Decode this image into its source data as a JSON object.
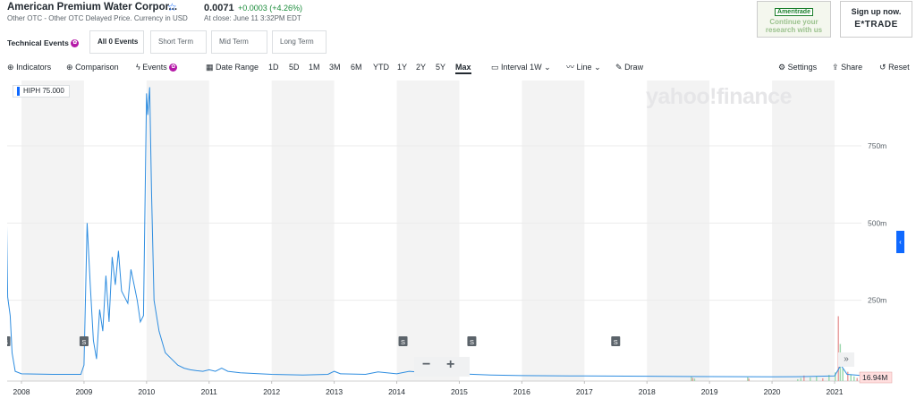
{
  "quote": {
    "name": "American Premium Water Corpor...",
    "exchange_info": "Other OTC - Other OTC Delayed Price. Currency in USD",
    "price": "0.0071",
    "change": "+0.0003 (+4.26%)",
    "close_time": "At close: June 11 3:32PM EDT"
  },
  "technical_events": {
    "label": "Technical Events",
    "badge": "✿",
    "buttons": [
      "All 0 Events",
      "Short Term",
      "Mid Term",
      "Long Term"
    ]
  },
  "toolbar": {
    "indicators": "Indicators",
    "comparison": "Comparison",
    "events": "Events",
    "date_range": "Date Range",
    "periods": [
      "1D",
      "5D",
      "1M",
      "3M",
      "6M",
      "YTD",
      "1Y",
      "2Y",
      "5Y",
      "Max"
    ],
    "active_period": "Max",
    "interval_label": "Interval",
    "interval_value": "1W",
    "line": "Line",
    "draw": "Draw",
    "settings": "Settings",
    "share": "Share",
    "reset": "Reset"
  },
  "ads": {
    "td_brand": "Ameritrade",
    "td_line1": "Continue your",
    "td_line2": "research with us",
    "etrade_line1": "Sign up now.",
    "etrade_line2": "E*TRADE"
  },
  "chart": {
    "legend": "HIPH 75.000",
    "watermark": "yahoo!finance",
    "last_volume": "16.94M",
    "colors": {
      "line": "#2e8de0",
      "shade": "#f3f3f3",
      "accent": "#0f69ff",
      "up": "#1a8c3a"
    }
  },
  "chart_data": {
    "type": "line",
    "series_name": "HIPH",
    "x_labels": [
      "2008",
      "2009",
      "2010",
      "2011",
      "2012",
      "2013",
      "2014",
      "2015",
      "2016",
      "2017",
      "2018",
      "2019",
      "2020",
      "2021"
    ],
    "y_ticks": [
      "750m",
      "500m",
      "250m"
    ],
    "ylim": [
      0,
      950
    ],
    "y_unit": "m",
    "split_markers": [
      "S",
      "S",
      "S",
      "S",
      "S"
    ],
    "split_dates": [
      2007.75,
      2009.0,
      2014.1,
      2015.2,
      2017.5
    ],
    "points": [
      [
        2007.75,
        700
      ],
      [
        2007.78,
        260
      ],
      [
        2007.82,
        200
      ],
      [
        2007.85,
        80
      ],
      [
        2007.9,
        20
      ],
      [
        2008.0,
        12
      ],
      [
        2008.5,
        10
      ],
      [
        2008.95,
        10
      ],
      [
        2009.0,
        40
      ],
      [
        2009.05,
        500
      ],
      [
        2009.1,
        300
      ],
      [
        2009.15,
        120
      ],
      [
        2009.2,
        60
      ],
      [
        2009.25,
        220
      ],
      [
        2009.3,
        150
      ],
      [
        2009.35,
        330
      ],
      [
        2009.4,
        180
      ],
      [
        2009.45,
        390
      ],
      [
        2009.5,
        300
      ],
      [
        2009.55,
        410
      ],
      [
        2009.6,
        280
      ],
      [
        2009.65,
        260
      ],
      [
        2009.7,
        240
      ],
      [
        2009.75,
        350
      ],
      [
        2009.8,
        300
      ],
      [
        2009.85,
        250
      ],
      [
        2009.9,
        180
      ],
      [
        2009.95,
        200
      ],
      [
        2010.0,
        920
      ],
      [
        2010.02,
        850
      ],
      [
        2010.05,
        940
      ],
      [
        2010.08,
        600
      ],
      [
        2010.12,
        250
      ],
      [
        2010.2,
        150
      ],
      [
        2010.3,
        80
      ],
      [
        2010.4,
        60
      ],
      [
        2010.5,
        40
      ],
      [
        2010.6,
        30
      ],
      [
        2010.7,
        25
      ],
      [
        2010.8,
        22
      ],
      [
        2010.9,
        20
      ],
      [
        2011.0,
        25
      ],
      [
        2011.1,
        20
      ],
      [
        2011.2,
        30
      ],
      [
        2011.3,
        20
      ],
      [
        2011.5,
        15
      ],
      [
        2012.0,
        10
      ],
      [
        2012.5,
        8
      ],
      [
        2012.9,
        10
      ],
      [
        2013.0,
        20
      ],
      [
        2013.1,
        12
      ],
      [
        2013.5,
        10
      ],
      [
        2013.7,
        18
      ],
      [
        2014.0,
        12
      ],
      [
        2014.2,
        20
      ],
      [
        2014.5,
        15
      ],
      [
        2014.8,
        20
      ],
      [
        2015.0,
        12
      ],
      [
        2015.5,
        8
      ],
      [
        2016.0,
        6
      ],
      [
        2017.0,
        5
      ],
      [
        2018.0,
        4
      ],
      [
        2019.0,
        3
      ],
      [
        2020.0,
        2
      ],
      [
        2020.5,
        3
      ],
      [
        2021.0,
        5
      ],
      [
        2021.1,
        40
      ],
      [
        2021.2,
        10
      ],
      [
        2021.4,
        7
      ]
    ],
    "volume_bars": [
      [
        2018.7,
        15
      ],
      [
        2018.72,
        10
      ],
      [
        2018.75,
        8
      ],
      [
        2019.6,
        12
      ],
      [
        2019.62,
        8
      ],
      [
        2020.4,
        6
      ],
      [
        2020.45,
        10
      ],
      [
        2020.5,
        18
      ],
      [
        2020.6,
        12
      ],
      [
        2020.7,
        15
      ],
      [
        2020.8,
        9
      ],
      [
        2020.9,
        20
      ],
      [
        2021.0,
        28
      ],
      [
        2021.05,
        210
      ],
      [
        2021.08,
        120
      ],
      [
        2021.12,
        40
      ],
      [
        2021.2,
        30
      ],
      [
        2021.25,
        20
      ],
      [
        2021.3,
        15
      ],
      [
        2021.35,
        10
      ]
    ]
  }
}
